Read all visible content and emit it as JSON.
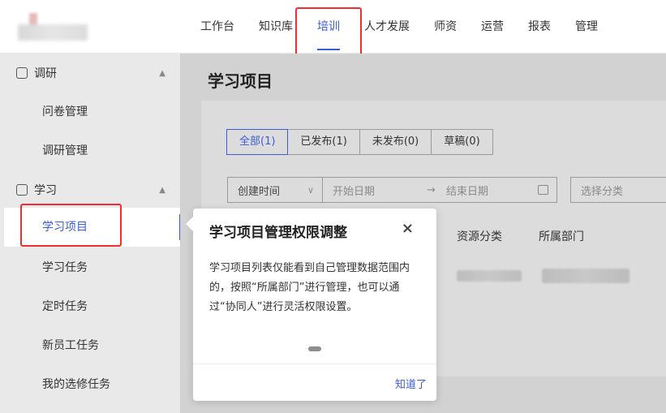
{
  "nav": {
    "items": [
      "工作台",
      "知识库",
      "培训",
      "人才发展",
      "师资",
      "运营",
      "报表",
      "管理"
    ],
    "active_index": 2
  },
  "sidebar": {
    "sections": [
      {
        "label": "调研",
        "items": [
          "问卷管理",
          "调研管理"
        ]
      },
      {
        "label": "学习",
        "items": [
          "学习项目",
          "学习任务",
          "定时任务",
          "新员工任务",
          "我的选修任务"
        ]
      }
    ],
    "active_item": "学习项目"
  },
  "main": {
    "title": "学习项目",
    "tabs": [
      "全部(1)",
      "已发布(1)",
      "未发布(0)",
      "草稿(0)"
    ],
    "filters": {
      "sort_value": "创建时间",
      "start_placeholder": "开始日期",
      "end_placeholder": "结束日期",
      "category_placeholder": "选择分类"
    },
    "columns": [
      "资源分类",
      "所属部门"
    ]
  },
  "popover": {
    "title": "学习项目管理权限调整",
    "body": "学习项目列表仅能看到自己管理数据范围内的，按照“所属部门”进行管理，也可以通过“协同人”进行灵活权限设置。",
    "ok_label": "知道了"
  },
  "colors": {
    "accent": "#3b5bdb",
    "highlight": "#f03030"
  },
  "icons": [
    "survey-icon",
    "study-icon",
    "chevron-up-icon",
    "calendar-icon",
    "close-icon",
    "arrow-right-icon"
  ]
}
